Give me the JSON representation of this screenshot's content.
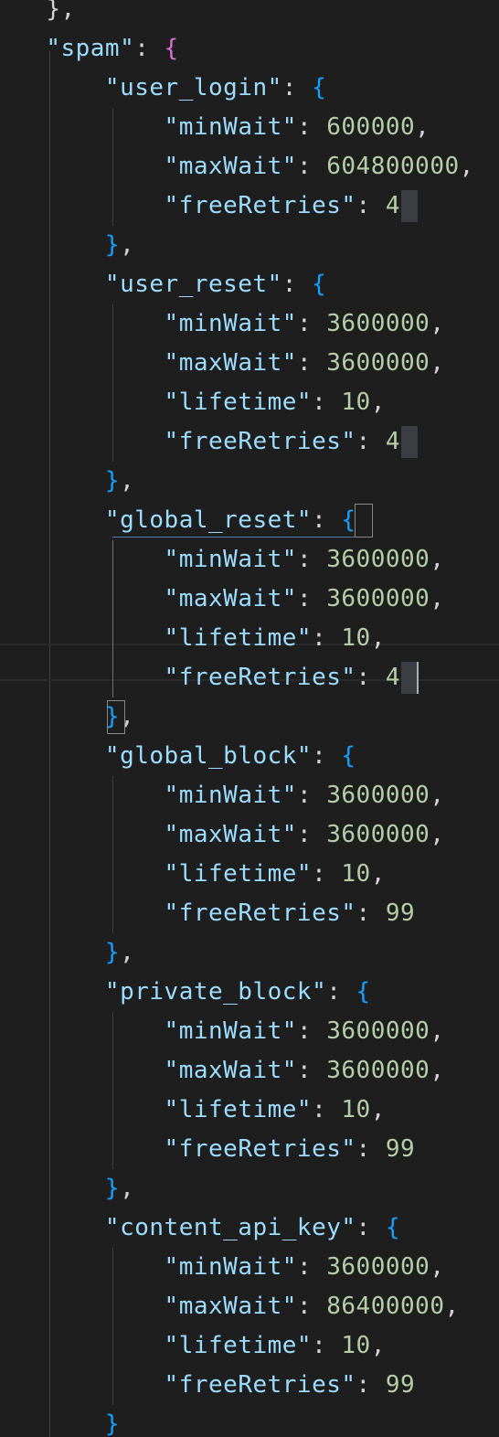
{
  "editor": {
    "language": "json",
    "theme": "dark"
  },
  "lines": [
    {
      "tokens": [
        {
          "t": "ws",
          "v": "  "
        },
        {
          "t": "punc",
          "v": "},"
        }
      ]
    },
    {
      "tokens": [
        {
          "t": "ws",
          "v": "  "
        },
        {
          "t": "key",
          "v": "\"spam\""
        },
        {
          "t": "punc",
          "v": ": "
        },
        {
          "t": "brace-spam",
          "v": "{"
        }
      ]
    },
    {
      "tokens": [
        {
          "t": "ws",
          "v": "      "
        },
        {
          "t": "key",
          "v": "\"user_login\""
        },
        {
          "t": "punc",
          "v": ": "
        },
        {
          "t": "brace",
          "v": "{"
        }
      ]
    },
    {
      "tokens": [
        {
          "t": "ws",
          "v": "          "
        },
        {
          "t": "key",
          "v": "\"minWait\""
        },
        {
          "t": "punc",
          "v": ": "
        },
        {
          "t": "num",
          "v": "600000"
        },
        {
          "t": "punc",
          "v": ","
        }
      ]
    },
    {
      "tokens": [
        {
          "t": "ws",
          "v": "          "
        },
        {
          "t": "key",
          "v": "\"maxWait\""
        },
        {
          "t": "punc",
          "v": ": "
        },
        {
          "t": "num",
          "v": "604800000"
        },
        {
          "t": "punc",
          "v": ","
        }
      ]
    },
    {
      "tokens": [
        {
          "t": "ws",
          "v": "          "
        },
        {
          "t": "key",
          "v": "\"freeRetries\""
        },
        {
          "t": "punc",
          "v": ": "
        },
        {
          "t": "num",
          "v": "4"
        }
      ]
    },
    {
      "tokens": [
        {
          "t": "ws",
          "v": "      "
        },
        {
          "t": "brace",
          "v": "}"
        },
        {
          "t": "punc",
          "v": ","
        }
      ]
    },
    {
      "tokens": [
        {
          "t": "ws",
          "v": "      "
        },
        {
          "t": "key",
          "v": "\"user_reset\""
        },
        {
          "t": "punc",
          "v": ": "
        },
        {
          "t": "brace",
          "v": "{"
        }
      ]
    },
    {
      "tokens": [
        {
          "t": "ws",
          "v": "          "
        },
        {
          "t": "key",
          "v": "\"minWait\""
        },
        {
          "t": "punc",
          "v": ": "
        },
        {
          "t": "num",
          "v": "3600000"
        },
        {
          "t": "punc",
          "v": ","
        }
      ]
    },
    {
      "tokens": [
        {
          "t": "ws",
          "v": "          "
        },
        {
          "t": "key",
          "v": "\"maxWait\""
        },
        {
          "t": "punc",
          "v": ": "
        },
        {
          "t": "num",
          "v": "3600000"
        },
        {
          "t": "punc",
          "v": ","
        }
      ]
    },
    {
      "tokens": [
        {
          "t": "ws",
          "v": "          "
        },
        {
          "t": "key",
          "v": "\"lifetime\""
        },
        {
          "t": "punc",
          "v": ": "
        },
        {
          "t": "num",
          "v": "10"
        },
        {
          "t": "punc",
          "v": ","
        }
      ]
    },
    {
      "tokens": [
        {
          "t": "ws",
          "v": "          "
        },
        {
          "t": "key",
          "v": "\"freeRetries\""
        },
        {
          "t": "punc",
          "v": ": "
        },
        {
          "t": "num",
          "v": "4"
        }
      ]
    },
    {
      "tokens": [
        {
          "t": "ws",
          "v": "      "
        },
        {
          "t": "brace",
          "v": "}"
        },
        {
          "t": "punc",
          "v": ","
        }
      ]
    },
    {
      "tokens": [
        {
          "t": "ws",
          "v": "      "
        },
        {
          "t": "key",
          "v": "\"global_reset\""
        },
        {
          "t": "punc",
          "v": ": "
        },
        {
          "t": "brace",
          "v": "{"
        }
      ]
    },
    {
      "tokens": [
        {
          "t": "ws",
          "v": "          "
        },
        {
          "t": "key",
          "v": "\"minWait\""
        },
        {
          "t": "punc",
          "v": ": "
        },
        {
          "t": "num",
          "v": "3600000"
        },
        {
          "t": "punc",
          "v": ","
        }
      ]
    },
    {
      "tokens": [
        {
          "t": "ws",
          "v": "          "
        },
        {
          "t": "key",
          "v": "\"maxWait\""
        },
        {
          "t": "punc",
          "v": ": "
        },
        {
          "t": "num",
          "v": "3600000"
        },
        {
          "t": "punc",
          "v": ","
        }
      ]
    },
    {
      "tokens": [
        {
          "t": "ws",
          "v": "          "
        },
        {
          "t": "key",
          "v": "\"lifetime\""
        },
        {
          "t": "punc",
          "v": ": "
        },
        {
          "t": "num",
          "v": "10"
        },
        {
          "t": "punc",
          "v": ","
        }
      ]
    },
    {
      "tokens": [
        {
          "t": "ws",
          "v": "          "
        },
        {
          "t": "key",
          "v": "\"freeRetries\""
        },
        {
          "t": "punc",
          "v": ": "
        },
        {
          "t": "num",
          "v": "4"
        }
      ]
    },
    {
      "tokens": [
        {
          "t": "ws",
          "v": "      "
        },
        {
          "t": "brace",
          "v": "}"
        },
        {
          "t": "punc",
          "v": ","
        }
      ]
    },
    {
      "tokens": [
        {
          "t": "ws",
          "v": "      "
        },
        {
          "t": "key",
          "v": "\"global_block\""
        },
        {
          "t": "punc",
          "v": ": "
        },
        {
          "t": "brace",
          "v": "{"
        }
      ]
    },
    {
      "tokens": [
        {
          "t": "ws",
          "v": "          "
        },
        {
          "t": "key",
          "v": "\"minWait\""
        },
        {
          "t": "punc",
          "v": ": "
        },
        {
          "t": "num",
          "v": "3600000"
        },
        {
          "t": "punc",
          "v": ","
        }
      ]
    },
    {
      "tokens": [
        {
          "t": "ws",
          "v": "          "
        },
        {
          "t": "key",
          "v": "\"maxWait\""
        },
        {
          "t": "punc",
          "v": ": "
        },
        {
          "t": "num",
          "v": "3600000"
        },
        {
          "t": "punc",
          "v": ","
        }
      ]
    },
    {
      "tokens": [
        {
          "t": "ws",
          "v": "          "
        },
        {
          "t": "key",
          "v": "\"lifetime\""
        },
        {
          "t": "punc",
          "v": ": "
        },
        {
          "t": "num",
          "v": "10"
        },
        {
          "t": "punc",
          "v": ","
        }
      ]
    },
    {
      "tokens": [
        {
          "t": "ws",
          "v": "          "
        },
        {
          "t": "key",
          "v": "\"freeRetries\""
        },
        {
          "t": "punc",
          "v": ": "
        },
        {
          "t": "num",
          "v": "99"
        }
      ]
    },
    {
      "tokens": [
        {
          "t": "ws",
          "v": "      "
        },
        {
          "t": "brace",
          "v": "}"
        },
        {
          "t": "punc",
          "v": ","
        }
      ]
    },
    {
      "tokens": [
        {
          "t": "ws",
          "v": "      "
        },
        {
          "t": "key",
          "v": "\"private_block\""
        },
        {
          "t": "punc",
          "v": ": "
        },
        {
          "t": "brace",
          "v": "{"
        }
      ]
    },
    {
      "tokens": [
        {
          "t": "ws",
          "v": "          "
        },
        {
          "t": "key",
          "v": "\"minWait\""
        },
        {
          "t": "punc",
          "v": ": "
        },
        {
          "t": "num",
          "v": "3600000"
        },
        {
          "t": "punc",
          "v": ","
        }
      ]
    },
    {
      "tokens": [
        {
          "t": "ws",
          "v": "          "
        },
        {
          "t": "key",
          "v": "\"maxWait\""
        },
        {
          "t": "punc",
          "v": ": "
        },
        {
          "t": "num",
          "v": "3600000"
        },
        {
          "t": "punc",
          "v": ","
        }
      ]
    },
    {
      "tokens": [
        {
          "t": "ws",
          "v": "          "
        },
        {
          "t": "key",
          "v": "\"lifetime\""
        },
        {
          "t": "punc",
          "v": ": "
        },
        {
          "t": "num",
          "v": "10"
        },
        {
          "t": "punc",
          "v": ","
        }
      ]
    },
    {
      "tokens": [
        {
          "t": "ws",
          "v": "          "
        },
        {
          "t": "key",
          "v": "\"freeRetries\""
        },
        {
          "t": "punc",
          "v": ": "
        },
        {
          "t": "num",
          "v": "99"
        }
      ]
    },
    {
      "tokens": [
        {
          "t": "ws",
          "v": "      "
        },
        {
          "t": "brace",
          "v": "}"
        },
        {
          "t": "punc",
          "v": ","
        }
      ]
    },
    {
      "tokens": [
        {
          "t": "ws",
          "v": "      "
        },
        {
          "t": "key",
          "v": "\"content_api_key\""
        },
        {
          "t": "punc",
          "v": ": "
        },
        {
          "t": "brace",
          "v": "{"
        }
      ]
    },
    {
      "tokens": [
        {
          "t": "ws",
          "v": "          "
        },
        {
          "t": "key",
          "v": "\"minWait\""
        },
        {
          "t": "punc",
          "v": ": "
        },
        {
          "t": "num",
          "v": "3600000"
        },
        {
          "t": "punc",
          "v": ","
        }
      ]
    },
    {
      "tokens": [
        {
          "t": "ws",
          "v": "          "
        },
        {
          "t": "key",
          "v": "\"maxWait\""
        },
        {
          "t": "punc",
          "v": ": "
        },
        {
          "t": "num",
          "v": "86400000"
        },
        {
          "t": "punc",
          "v": ","
        }
      ]
    },
    {
      "tokens": [
        {
          "t": "ws",
          "v": "          "
        },
        {
          "t": "key",
          "v": "\"lifetime\""
        },
        {
          "t": "punc",
          "v": ": "
        },
        {
          "t": "num",
          "v": "10"
        },
        {
          "t": "punc",
          "v": ","
        }
      ]
    },
    {
      "tokens": [
        {
          "t": "ws",
          "v": "          "
        },
        {
          "t": "key",
          "v": "\"freeRetries\""
        },
        {
          "t": "punc",
          "v": ": "
        },
        {
          "t": "num",
          "v": "99"
        }
      ]
    },
    {
      "tokens": [
        {
          "t": "ws",
          "v": "      "
        },
        {
          "t": "brace",
          "v": "}"
        }
      ]
    }
  ],
  "cursor_line_index": 17,
  "matched_bracket_lines": [
    13,
    18
  ],
  "colors": {
    "background": "#1e1e1e",
    "key": "#9cdcfe",
    "number": "#b5cea8",
    "punctuation": "#d4d4d4",
    "spam_brace": "#da70d6",
    "nested_brace": "#179fff"
  }
}
